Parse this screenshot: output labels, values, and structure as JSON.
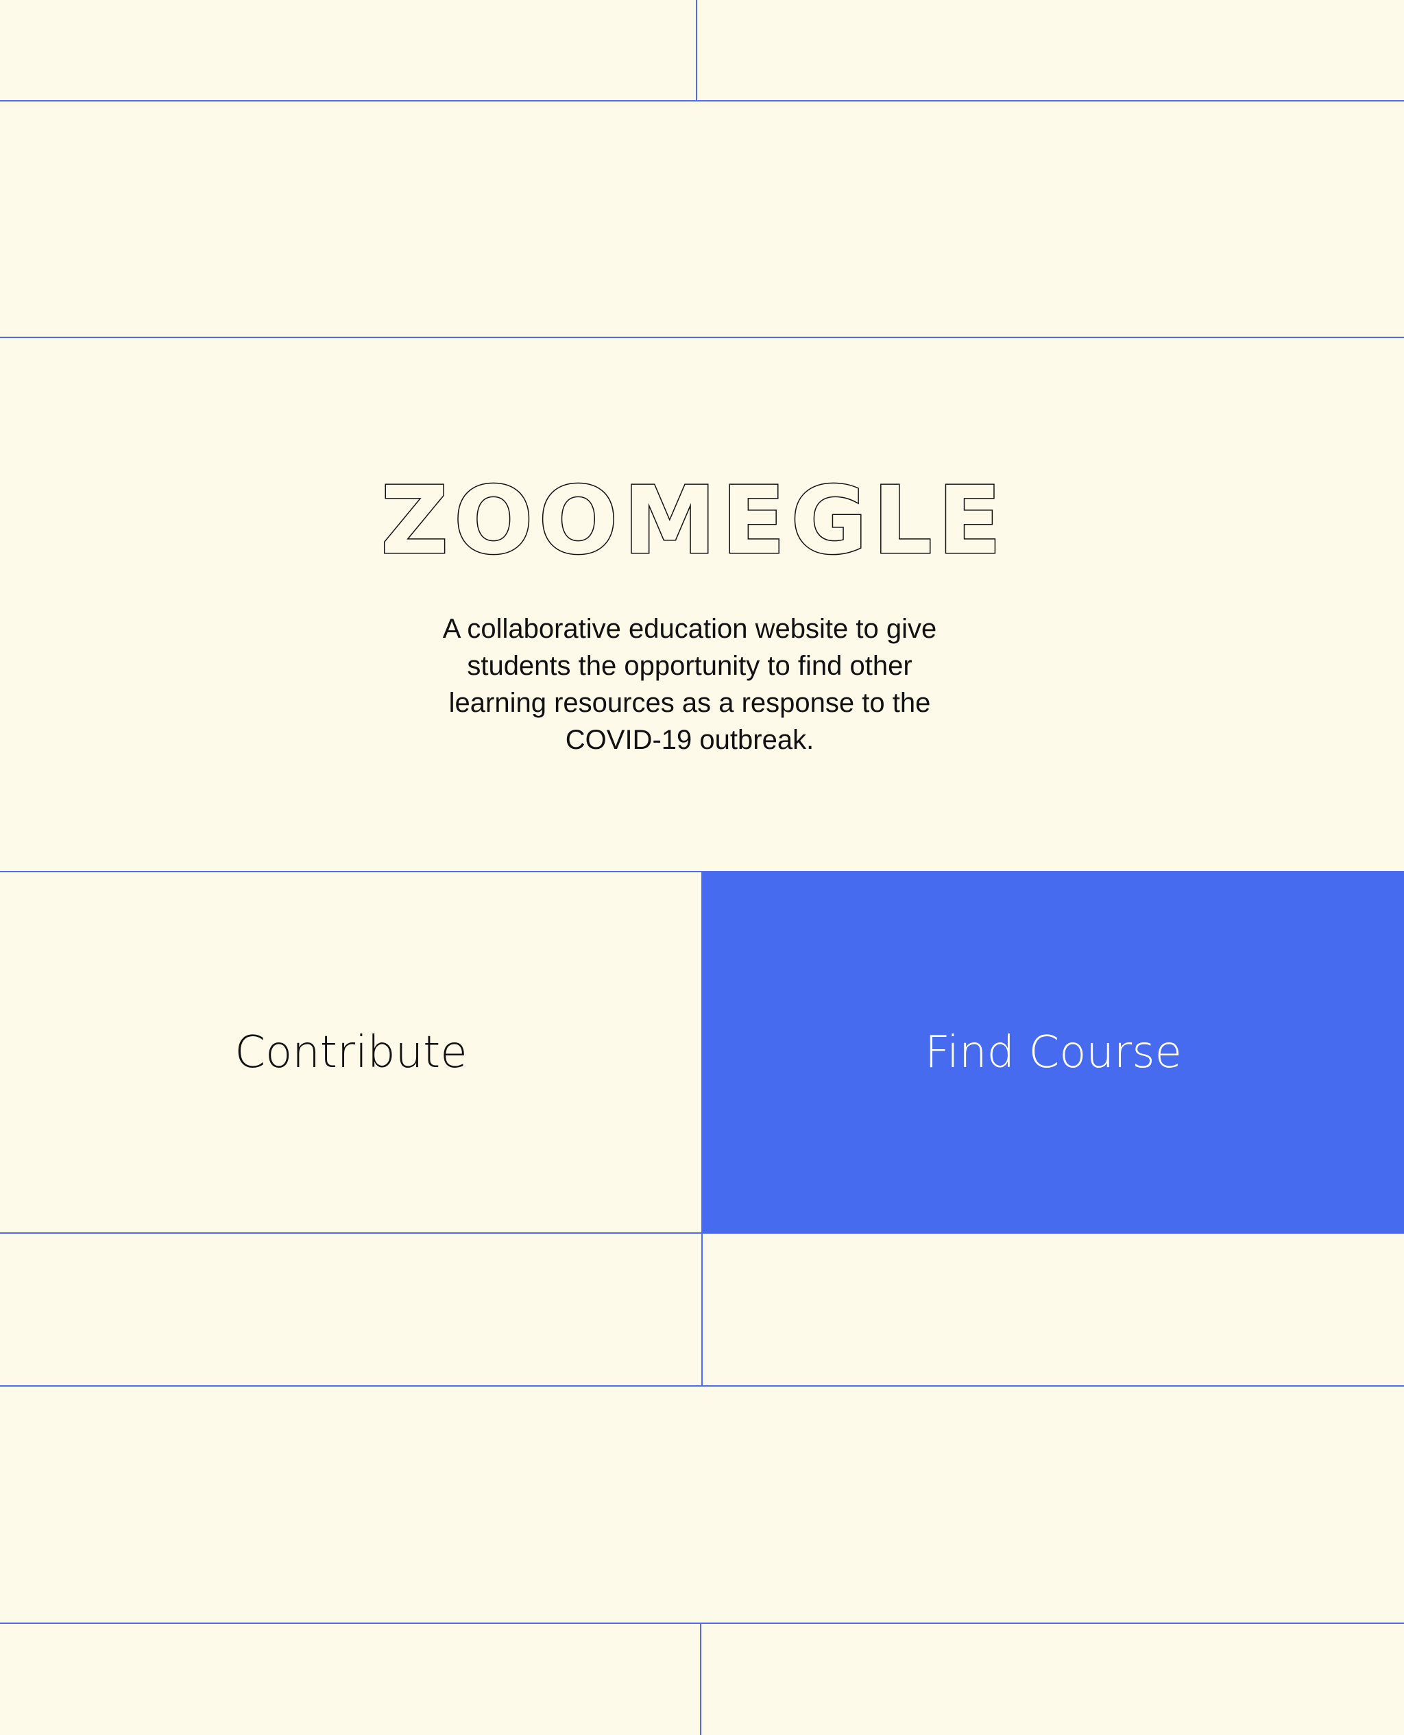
{
  "brand": {
    "logo_text": "ZOOMEGLE",
    "tagline": "A collaborative education website to give\nstudents the opportunity to find other\nlearning resources  as a response to the\nCOVID-19 outbreak."
  },
  "actions": {
    "contribute_label": "Contribute",
    "find_course_label": "Find Course"
  },
  "colors": {
    "background": "#FEFAEA",
    "grid_line": "#4A6CF7",
    "accent": "#466BEF",
    "text": "#111111"
  }
}
